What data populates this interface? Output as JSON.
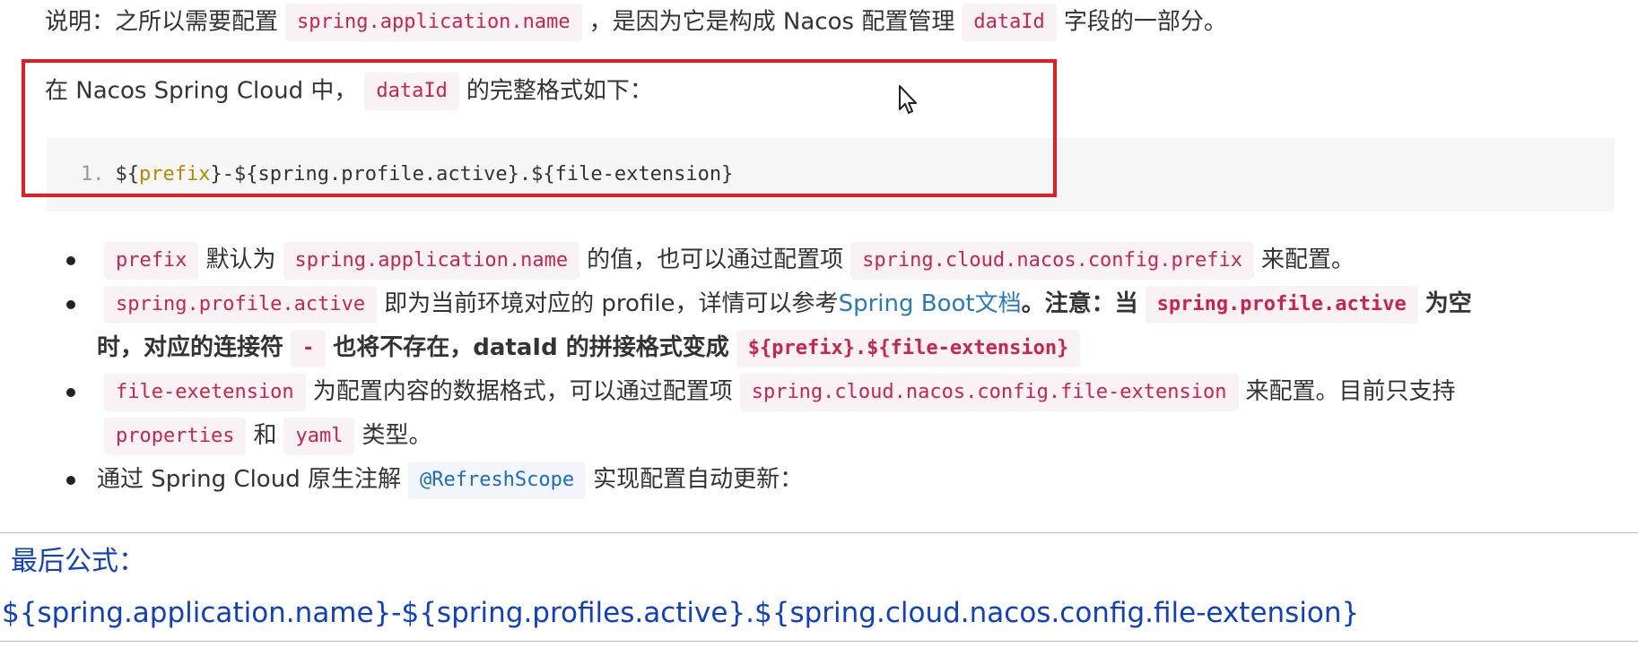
{
  "note": {
    "prefix": "说明：之所以需要配置",
    "code1": "spring.application.name",
    "middle": "，是因为它是构成 Nacos 配置管理",
    "code2": "dataId",
    "suffix": "字段的一部分。"
  },
  "intro": {
    "prefix": "在 Nacos Spring Cloud 中，",
    "code": "dataId",
    "suffix": "的完整格式如下："
  },
  "code_block": {
    "line_number": "1.",
    "parts": [
      "${",
      "prefix",
      "}",
      "-",
      "${",
      "spring.profile.active",
      "}",
      ".",
      "${",
      "file-extension",
      "}"
    ]
  },
  "bullets": [
    {
      "code_a": "prefix",
      "text_a": "默认为",
      "code_b": "spring.application.name",
      "text_b": "的值，也可以通过配置项",
      "code_c": "spring.cloud.nacos.config.prefix",
      "text_c": "来配置。"
    },
    {
      "code_a": "spring.profile.active",
      "text_a": "即为当前环境对应的 profile，详情可以参考",
      "link": "Spring Boot文档",
      "bold_a": "。注意：当",
      "code_b": "spring.profile.active",
      "bold_b": "为空",
      "bold_c": "时，对应的连接符",
      "code_c": "-",
      "bold_d": "也将不存在，dataId 的拼接格式变成",
      "code_d": "${prefix}.${file-extension}"
    },
    {
      "code_a": "file-exetension",
      "text_a": "为配置内容的数据格式，可以通过配置项",
      "code_b": "spring.cloud.nacos.config.file-extension",
      "text_b": "来配置。目前只支持",
      "code_c": "properties",
      "text_c": "和",
      "code_d": "yaml",
      "text_d": "类型。"
    },
    {
      "text_a": "通过 Spring Cloud 原生注解",
      "code_a": "@RefreshScope",
      "text_b": "实现配置自动更新："
    }
  ],
  "formula": {
    "label": "最后公式：",
    "value": "${spring.application.name}-${spring.profiles.active}.${spring.cloud.nacos.config.file-extension}"
  },
  "colors": {
    "highlight_border": "#e0201f",
    "code_text": "#c7254e",
    "formula_text": "#1040c0",
    "link": "#2a7ab8"
  }
}
